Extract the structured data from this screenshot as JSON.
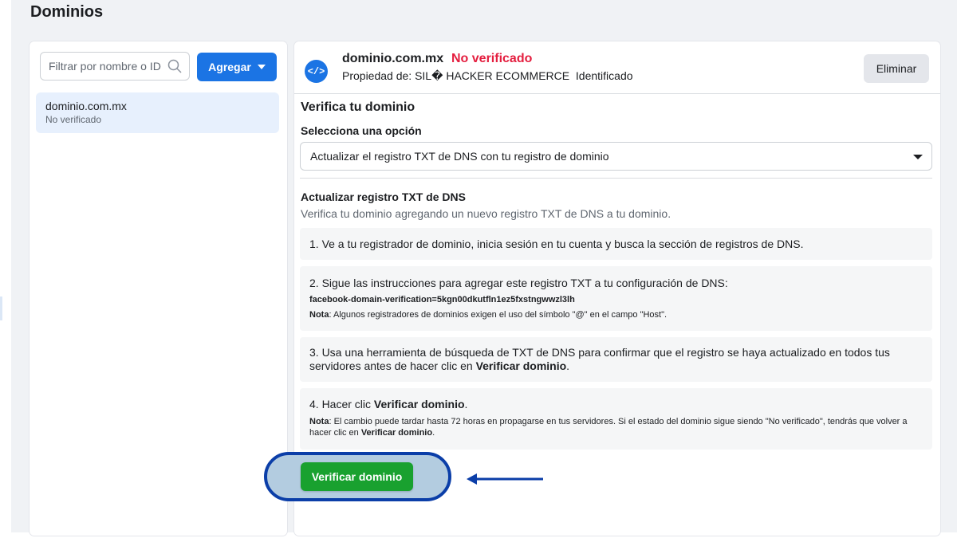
{
  "page": {
    "title": "Dominios"
  },
  "sidebar": {
    "filter_placeholder": "Filtrar por nombre o ID",
    "add_button_label": "Agregar",
    "domains": [
      {
        "name": "dominio.com.mx",
        "status": "No verificado"
      }
    ]
  },
  "domain_detail": {
    "name": "dominio.com.mx",
    "status": "No verificado",
    "status_color": "#e41e3f",
    "property_label": "Propiedad de: SIL� HACKER ECOMMERCE",
    "property_id": "Identificado",
    "delete_label": "Eliminar",
    "icon": "code-icon"
  },
  "verify": {
    "title": "Verifica tu dominio",
    "select_label": "Selecciona una opción",
    "selected_option": "Actualizar el registro TXT de DNS con tu registro de dominio",
    "dns_title": "Actualizar registro TXT de DNS",
    "dns_subtitle": "Verifica tu dominio agregando un nuevo registro TXT de DNS a tu dominio.",
    "steps": [
      {
        "text": "1. Ve a tu registrador de dominio, inicia sesión en tu cuenta y busca la sección de registros de DNS."
      },
      {
        "text": "2. Sigue las instrucciones para agregar este registro TXT a tu configuración de DNS:",
        "code": "facebook-domain-verification=5kgn00dkutfln1ez5fxstngwwzl3lh",
        "note_label": "Nota",
        "note": ": Algunos registradores de dominios exigen el uso del símbolo \"@\" en el campo \"Host\"."
      },
      {
        "text": "3. Usa una herramienta de búsqueda de TXT de DNS para confirmar que el registro se haya actualizado en todos tus servidores antes de hacer clic en ",
        "text_bold": "Verificar dominio",
        "text_end": "."
      },
      {
        "text": "4. Hacer clic ",
        "text_bold": "Verificar dominio",
        "text_end": ".",
        "note_label": "Nota",
        "note": ": El cambio puede tardar hasta 72 horas en propagarse en tus servidores. Si el estado del dominio sigue siendo \"No verificado\", tendrás que volver a hacer clic en ",
        "note_bold": "Verificar dominio",
        "note_end": "."
      }
    ],
    "button_label": "Verificar dominio",
    "button_color": "#19a12f"
  },
  "colors": {
    "primary": "#1b74e4",
    "highlight_ring": "#0b3ea8"
  }
}
